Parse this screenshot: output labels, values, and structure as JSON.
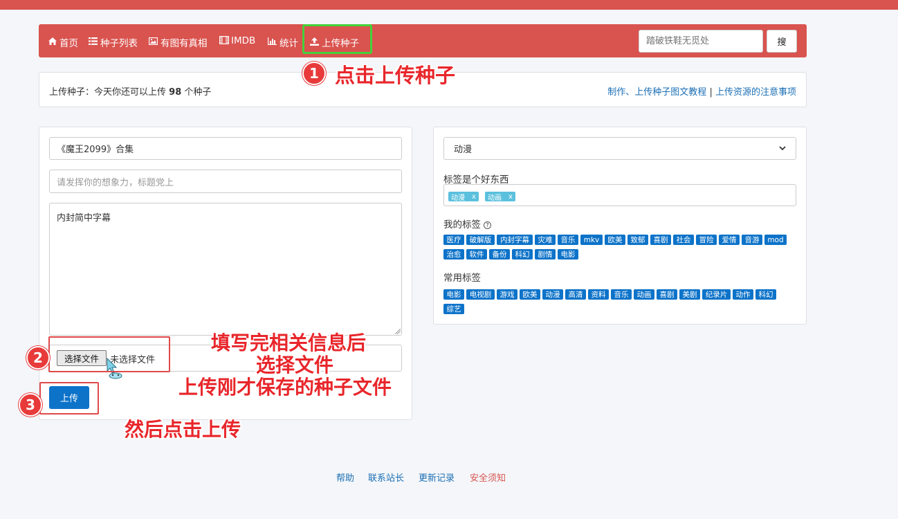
{
  "nav": {
    "items": [
      {
        "label": "首页",
        "icon": "home-icon"
      },
      {
        "label": "种子列表",
        "icon": "list-icon"
      },
      {
        "label": "有图有真相",
        "icon": "image-icon"
      },
      {
        "label": "IMDB",
        "icon": "film-icon"
      },
      {
        "label": "统计",
        "icon": "bar-chart-icon"
      },
      {
        "label": "上传种子",
        "icon": "upload-icon"
      }
    ],
    "search_placeholder": "踏破铁鞋无觅处",
    "search_button": "搜"
  },
  "info": {
    "prefix": "上传种子：今天你还可以上传",
    "count": "98",
    "suffix": "个种子",
    "link_tutorial": "制作、上传种子图文教程",
    "separator": "|",
    "link_notice": "上传资源的注意事项"
  },
  "form": {
    "title_value": "《魔王2099》合集",
    "subtitle_placeholder": "请发挥你的想象力，标题党上",
    "description_value": "内封简中字幕",
    "file_button": "选择文件",
    "file_status": "未选择文件",
    "upload_button": "上传"
  },
  "side": {
    "category_value": "动漫",
    "tags_label": "标签是个好东西",
    "selected_tags": [
      "动漫",
      "动画"
    ],
    "chip_remove": "x",
    "my_tags_label": "我的标签",
    "my_tags": [
      "医疗",
      "破解版",
      "内封字幕",
      "灾难",
      "音乐",
      "mkv",
      "欧美",
      "致郁",
      "喜剧",
      "社会",
      "冒险",
      "爱情",
      "音游",
      "mod",
      "治愈",
      "软件",
      "备份",
      "科幻",
      "剧情",
      "电影"
    ],
    "common_tags_label": "常用标签",
    "common_tags": [
      "电影",
      "电视剧",
      "游戏",
      "欧美",
      "动漫",
      "高清",
      "资料",
      "音乐",
      "动画",
      "喜剧",
      "美剧",
      "纪录片",
      "动作",
      "科幻",
      "综艺"
    ]
  },
  "annotations": {
    "step1_num": "1",
    "step1_text": "点击上传种子",
    "step2_num": "2",
    "step2_line1": "填写完相关信息后",
    "step2_line2": "选择文件",
    "step2_line3": "上传刚才保存的种子文件",
    "step3_num": "3",
    "step3_text": "然后点击上传"
  },
  "footer": {
    "links": [
      "帮助",
      "联系站长",
      "更新记录",
      "安全须知"
    ]
  },
  "colors": {
    "nav_bg": "#d9534f",
    "primary": "#0d73c9",
    "chip": "#5bc0de",
    "annotation_red": "#e8262b",
    "highlight_green": "#44d13a"
  }
}
